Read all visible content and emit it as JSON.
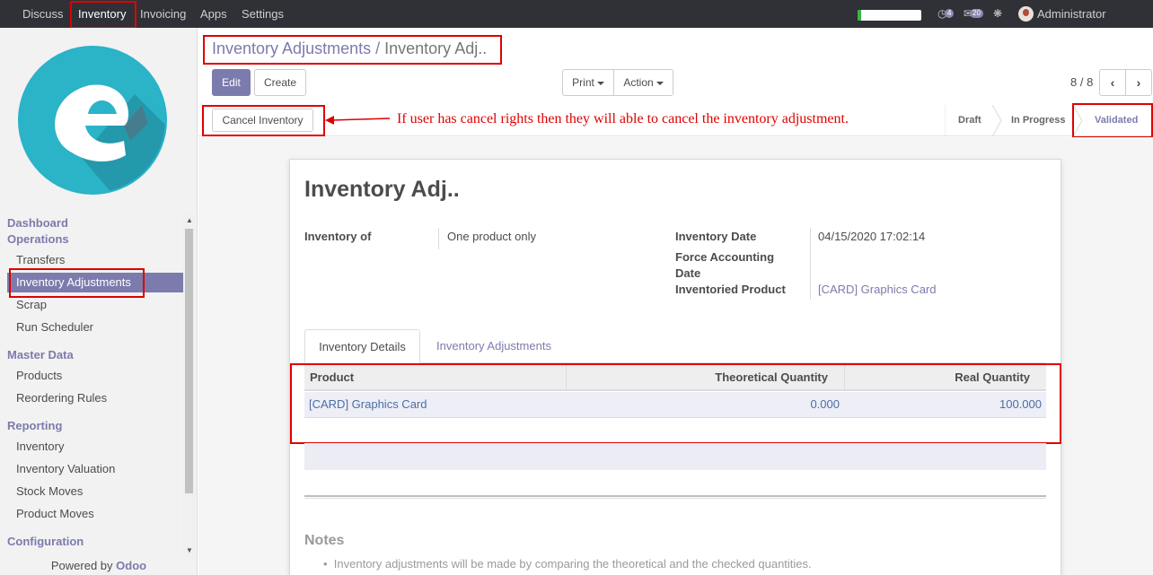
{
  "topbar": {
    "menus": [
      "Discuss",
      "Inventory",
      "Invoicing",
      "Apps",
      "Settings"
    ],
    "active_menu": "Inventory",
    "activity_count": "4",
    "message_count": "20",
    "user": "Administrator",
    "icons": [
      "clock-icon",
      "chat-icon",
      "bug-icon"
    ]
  },
  "sidebar": {
    "sections": [
      {
        "title": "Dashboard"
      },
      {
        "title": "Operations",
        "items": [
          "Transfers",
          "Inventory Adjustments",
          "Scrap",
          "Run Scheduler"
        ]
      },
      {
        "title": "Master Data",
        "items": [
          "Products",
          "Reordering Rules"
        ]
      },
      {
        "title": "Reporting",
        "items": [
          "Inventory",
          "Inventory Valuation",
          "Stock Moves",
          "Product Moves"
        ]
      },
      {
        "title": "Configuration"
      }
    ],
    "active_item": "Inventory Adjustments",
    "powered_prefix": "Powered by",
    "powered_brand": "Odoo"
  },
  "control": {
    "breadcrumb_parent": "Inventory Adjustments",
    "breadcrumb_sep": "/",
    "breadcrumb_current": "Inventory Adj..",
    "edit_label": "Edit",
    "create_label": "Create",
    "print_label": "Print",
    "action_label": "Action",
    "pager": "8 / 8"
  },
  "statusbar": {
    "cancel_label": "Cancel Inventory",
    "stages": [
      "Draft",
      "In Progress",
      "Validated"
    ],
    "active_stage": "Validated"
  },
  "annotation": {
    "text": "If user has cancel rights then they will able to cancel the inventory adjustment.",
    "color": "#e00000"
  },
  "form": {
    "title": "Inventory Adj..",
    "inventory_of_label": "Inventory of",
    "inventory_of_value": "One product only",
    "inventory_date_label": "Inventory Date",
    "inventory_date_value": "04/15/2020 17:02:14",
    "force_accounting_label_1": "Force Accounting",
    "force_accounting_label_2": "Date",
    "inventoried_product_label": "Inventoried Product",
    "inventoried_product_value": "[CARD] Graphics Card",
    "tabs": [
      "Inventory Details",
      "Inventory Adjustments"
    ],
    "table": {
      "columns": [
        "Product",
        "Theoretical Quantity",
        "Real Quantity"
      ],
      "rows": [
        [
          "[CARD] Graphics Card",
          "0.000",
          "100.000"
        ]
      ]
    },
    "notes_title": "Notes",
    "notes_text": "Inventory adjustments will be made by comparing the theoretical and the checked quantities."
  },
  "colors": {
    "brand": "#7c7bad",
    "navbar": "#2f3136",
    "highlight_box": "#e00000"
  }
}
